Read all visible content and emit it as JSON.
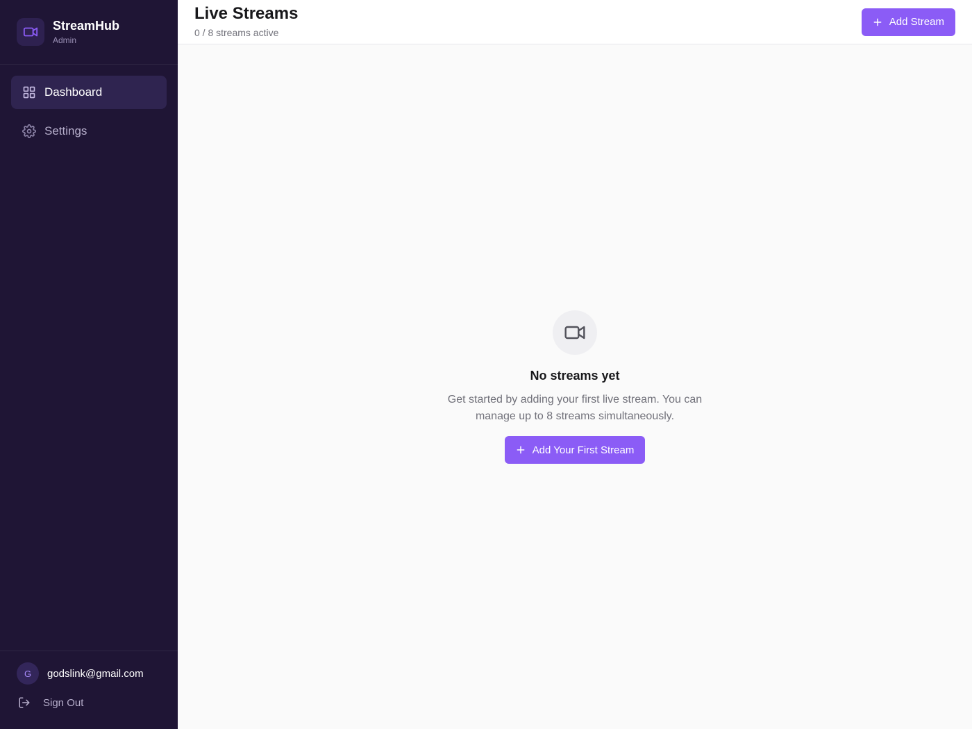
{
  "brand": {
    "name": "StreamHub",
    "role": "Admin"
  },
  "sidebar": {
    "items": [
      {
        "label": "Dashboard",
        "icon": "grid-icon",
        "active": true
      },
      {
        "label": "Settings",
        "icon": "gear-icon",
        "active": false
      }
    ]
  },
  "user": {
    "initial": "G",
    "email": "godslink@gmail.com",
    "signout_label": "Sign Out"
  },
  "header": {
    "title": "Live Streams",
    "subtitle": "0 / 8 streams active",
    "add_button_label": "Add Stream"
  },
  "empty_state": {
    "icon": "video-camera-icon",
    "title": "No streams yet",
    "description": "Get started by adding your first live stream. You can manage up to 8 streams simultaneously.",
    "button_label": "Add Your First Stream"
  },
  "colors": {
    "sidebar_bg": "#1f1535",
    "accent": "#8b5cf6",
    "active_nav_bg": "#2f2450",
    "content_bg": "#fafafa"
  }
}
